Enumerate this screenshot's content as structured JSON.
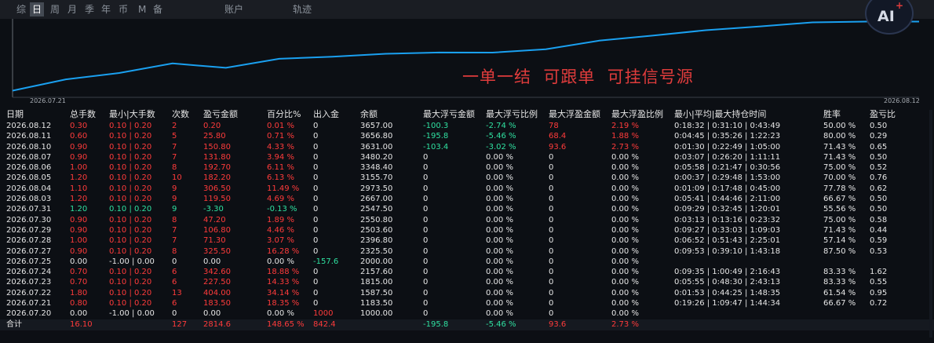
{
  "tabs": [
    "综",
    "日",
    "周",
    "月",
    "季",
    "年",
    "币",
    "M",
    "备",
    "账户",
    "轨迹"
  ],
  "active_tab": "日",
  "chart": {
    "start_label": "2026.07.21",
    "end_label": "2026.08.12",
    "line_color": "#1aa0f0"
  },
  "overlay_text": "一单一结  可跟单  可挂信号源",
  "logo_text": "AI",
  "logo_plus": "+",
  "colors": {
    "profit": "#ff3b3b",
    "loss": "#2fe0a0",
    "text": "#e6e6e6",
    "background": "#0c0f14"
  },
  "table": {
    "headers": [
      "日期",
      "总手数",
      "最小|大手数",
      "次数",
      "盈亏金额",
      "百分比%",
      "出入金",
      "余额",
      "最大浮亏金额",
      "最大浮亏比例",
      "最大浮盈金额",
      "最大浮盈比例",
      "最小|平均|最大持仓时间",
      "胜率",
      "盈亏比"
    ],
    "rows": [
      [
        "2026.08.12",
        "0.30",
        "0.10 | 0.20",
        "2",
        "0.20",
        "0.01 %",
        "0",
        "3657.00",
        "-100.3",
        "-2.74 %",
        "78",
        "2.19 %",
        "0:18:32 | 0:31:10 | 0:43:49",
        "50.00 %",
        "0.50"
      ],
      [
        "2026.08.11",
        "0.60",
        "0.10 | 0.20",
        "5",
        "25.80",
        "0.71 %",
        "0",
        "3656.80",
        "-195.8",
        "-5.46 %",
        "68.4",
        "1.88 %",
        "0:04:45 | 0:35:26 | 1:22:23",
        "80.00 %",
        "0.29"
      ],
      [
        "2026.08.10",
        "0.90",
        "0.10 | 0.20",
        "7",
        "150.80",
        "4.33 %",
        "0",
        "3631.00",
        "-103.4",
        "-3.02 %",
        "93.6",
        "2.73 %",
        "0:01:30 | 0:22:49 | 1:05:00",
        "71.43 %",
        "0.65"
      ],
      [
        "2026.08.07",
        "0.90",
        "0.10 | 0.20",
        "7",
        "131.80",
        "3.94 %",
        "0",
        "3480.20",
        "0",
        "0.00 %",
        "0",
        "0.00 %",
        "0:03:07 | 0:26:20 | 1:11:11",
        "71.43 %",
        "0.50"
      ],
      [
        "2026.08.06",
        "1.00",
        "0.10 | 0.20",
        "8",
        "192.70",
        "6.11 %",
        "0",
        "3348.40",
        "0",
        "0.00 %",
        "0",
        "0.00 %",
        "0:05:58 | 0:21:47 | 0:30:56",
        "75.00 %",
        "0.52"
      ],
      [
        "2026.08.05",
        "1.20",
        "0.10 | 0.20",
        "10",
        "182.20",
        "6.13 %",
        "0",
        "3155.70",
        "0",
        "0.00 %",
        "0",
        "0.00 %",
        "0:00:37 | 0:29:48 | 1:53:00",
        "70.00 %",
        "0.76"
      ],
      [
        "2026.08.04",
        "1.10",
        "0.10 | 0.20",
        "9",
        "306.50",
        "11.49 %",
        "0",
        "2973.50",
        "0",
        "0.00 %",
        "0",
        "0.00 %",
        "0:01:09 | 0:17:48 | 0:45:00",
        "77.78 %",
        "0.62"
      ],
      [
        "2026.08.03",
        "1.20",
        "0.10 | 0.20",
        "9",
        "119.50",
        "4.69 %",
        "0",
        "2667.00",
        "0",
        "0.00 %",
        "0",
        "0.00 %",
        "0:05:41 | 0:44:46 | 2:11:00",
        "66.67 %",
        "0.50"
      ],
      [
        "2026.07.31",
        "1.20",
        "0.10 | 0.20",
        "9",
        "-3.30",
        "-0.13 %",
        "0",
        "2547.50",
        "0",
        "0.00 %",
        "0",
        "0.00 %",
        "0:09:29 | 0:32:45 | 1:20:01",
        "55.56 %",
        "0.50"
      ],
      [
        "2026.07.30",
        "0.90",
        "0.10 | 0.20",
        "8",
        "47.20",
        "1.89 %",
        "0",
        "2550.80",
        "0",
        "0.00 %",
        "0",
        "0.00 %",
        "0:03:13 | 0:13:16 | 0:23:32",
        "75.00 %",
        "0.58"
      ],
      [
        "2026.07.29",
        "0.90",
        "0.10 | 0.20",
        "7",
        "106.80",
        "4.46 %",
        "0",
        "2503.60",
        "0",
        "0.00 %",
        "0",
        "0.00 %",
        "0:09:27 | 0:33:03 | 1:09:03",
        "71.43 %",
        "0.44"
      ],
      [
        "2026.07.28",
        "1.00",
        "0.10 | 0.20",
        "7",
        "71.30",
        "3.07 %",
        "0",
        "2396.80",
        "0",
        "0.00 %",
        "0",
        "0.00 %",
        "0:06:52 | 0:51:43 | 2:25:01",
        "57.14 %",
        "0.59"
      ],
      [
        "2026.07.27",
        "0.90",
        "0.10 | 0.20",
        "8",
        "325.50",
        "16.28 %",
        "0",
        "2325.50",
        "0",
        "0.00 %",
        "0",
        "0.00 %",
        "0:09:53 | 0:39:10 | 1:43:18",
        "87.50 %",
        "0.53"
      ],
      [
        "2026.07.25",
        "0.00",
        "-1.00 | 0.00",
        "0",
        "0.00",
        "0.00 %",
        "-157.6",
        "2000.00",
        "0",
        "0.00 %",
        "0",
        "0.00 %",
        "",
        "",
        ""
      ],
      [
        "2026.07.24",
        "0.70",
        "0.10 | 0.20",
        "6",
        "342.60",
        "18.88 %",
        "0",
        "2157.60",
        "0",
        "0.00 %",
        "0",
        "0.00 %",
        "0:09:35 | 1:00:49 | 2:16:43",
        "83.33 %",
        "1.62"
      ],
      [
        "2026.07.23",
        "0.70",
        "0.10 | 0.20",
        "6",
        "227.50",
        "14.33 %",
        "0",
        "1815.00",
        "0",
        "0.00 %",
        "0",
        "0.00 %",
        "0:05:55 | 0:48:30 | 2:43:13",
        "83.33 %",
        "0.55"
      ],
      [
        "2026.07.22",
        "1.80",
        "0.10 | 0.20",
        "13",
        "404.00",
        "34.14 %",
        "0",
        "1587.50",
        "0",
        "0.00 %",
        "0",
        "0.00 %",
        "0:01:53 | 0:44:25 | 1:48:35",
        "61.54 %",
        "0.95"
      ],
      [
        "2026.07.21",
        "0.80",
        "0.10 | 0.20",
        "6",
        "183.50",
        "18.35 %",
        "0",
        "1183.50",
        "0",
        "0.00 %",
        "0",
        "0.00 %",
        "0:19:26 | 1:09:47 | 1:44:34",
        "66.67 %",
        "0.72"
      ],
      [
        "2026.07.20",
        "0.00",
        "-1.00 | 0.00",
        "0",
        "0.00",
        "0.00 %",
        "1000",
        "1000.00",
        "0",
        "0.00 %",
        "0",
        "0.00 %",
        "",
        "",
        ""
      ]
    ],
    "total": [
      "合计",
      "16.10",
      "",
      "127",
      "2814.6",
      "148.65 %",
      "842.4",
      "",
      "-195.8",
      "-5.46 %",
      "93.6",
      "2.73 %",
      "",
      "",
      ""
    ]
  },
  "chart_data": {
    "type": "line",
    "x": [
      "2026.07.21",
      "2026.07.22",
      "2026.07.23",
      "2026.07.24",
      "2026.07.25",
      "2026.07.27",
      "2026.07.28",
      "2026.07.29",
      "2026.07.30",
      "2026.07.31",
      "2026.08.03",
      "2026.08.04",
      "2026.08.05",
      "2026.08.06",
      "2026.08.07",
      "2026.08.10",
      "2026.08.11",
      "2026.08.12"
    ],
    "values": [
      1183.5,
      1587.5,
      1815.0,
      2157.6,
      2000.0,
      2325.5,
      2396.8,
      2503.6,
      2550.8,
      2547.5,
      2667.0,
      2973.5,
      3155.7,
      3348.4,
      3480.2,
      3631.0,
      3656.8,
      3657.0
    ],
    "ylim": [
      1000,
      3700
    ],
    "grid": false
  }
}
